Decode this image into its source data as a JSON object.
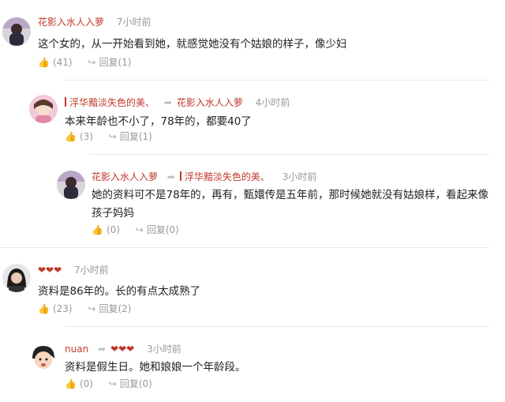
{
  "comments": [
    {
      "user": "花影入水人入萝",
      "time": "7小时前",
      "text": "这个女的，从一开始看到她，就感觉她没有个姑娘的样子，像少妇",
      "likes": "(41)",
      "reply": "回复(1)"
    },
    {
      "user": "浮华黯淡失色的美、",
      "reply_to": "花影入水人入萝",
      "time": "4小时前",
      "text": "本来年龄也不小了，78年的，都要40了",
      "likes": "(3)",
      "reply": "回复(1)"
    },
    {
      "user": "花影入水人入萝",
      "reply_to": "浮华黯淡失色的美、",
      "time": "3小时前",
      "text_line1": "她的资料可不是78年的，再有，甄嬛传是五年前，那时候她就没有姑娘样，看起来像",
      "text_line2": "孩子妈妈",
      "likes": "(0)",
      "reply": "回复(0)"
    },
    {
      "user": "❤❤❤",
      "time": "7小时前",
      "text": "资料是86年的。长的有点太成熟了",
      "likes": "(23)",
      "reply": "回复(2)"
    },
    {
      "user": "nuan",
      "reply_to": "❤❤❤",
      "time": "3小时前",
      "text": "资料是假生日。她和娘娘一个年龄段。",
      "likes": "(0)",
      "reply": "回复(0)"
    }
  ],
  "icons": {
    "like": "thumbs-up-icon",
    "reply": "reply-arrow-icon"
  },
  "colors": {
    "username": "#c0392b",
    "meta": "#999999"
  }
}
